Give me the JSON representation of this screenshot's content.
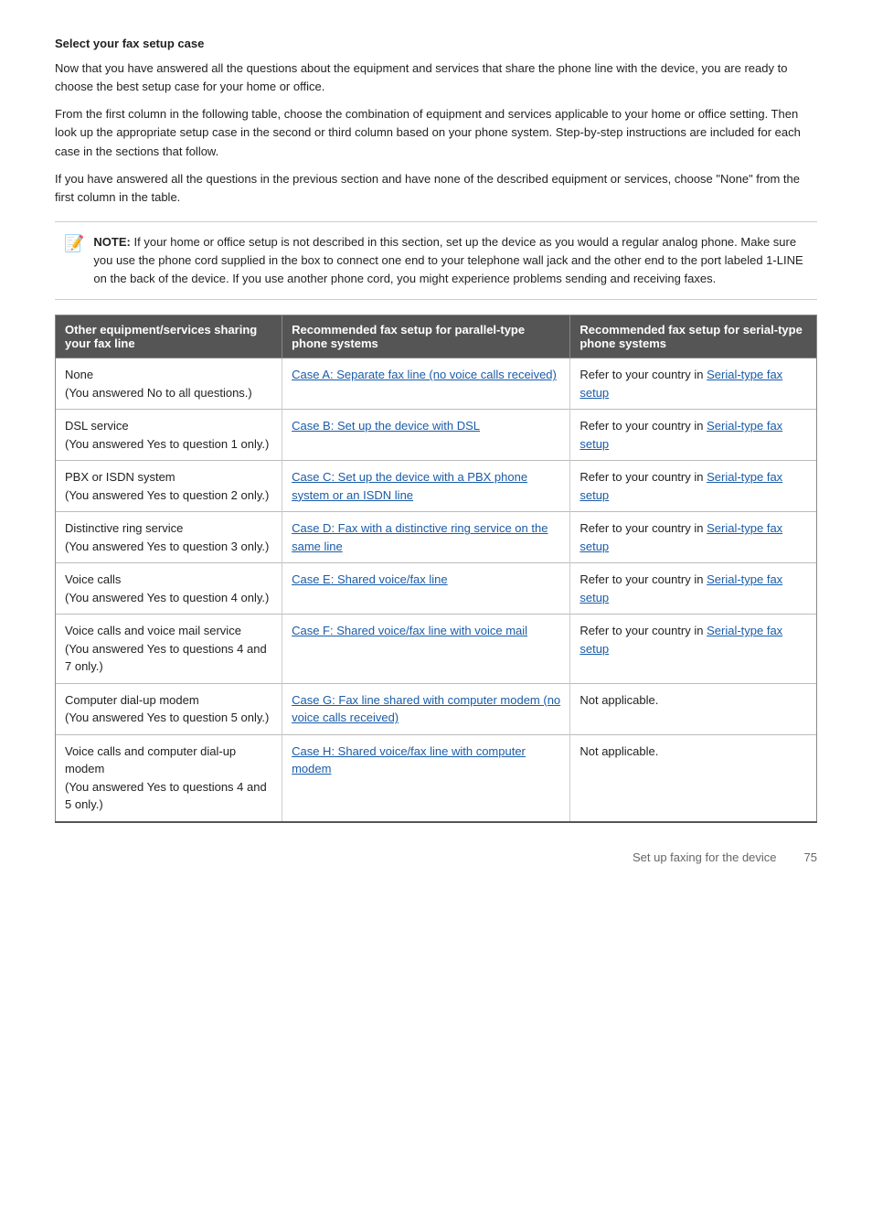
{
  "page": {
    "section_title": "Select your fax setup case",
    "paragraphs": [
      "Now that you have answered all the questions about the equipment and services that share the phone line with the device, you are ready to choose the best setup case for your home or office.",
      "From the first column in the following table, choose the combination of equipment and services applicable to your home or office setting. Then look up the appropriate setup case in the second or third column based on your phone system. Step-by-step instructions are included for each case in the sections that follow.",
      "If you have answered all the questions in the previous section and have none of the described equipment or services, choose \"None\" from the first column in the table."
    ],
    "note_label": "NOTE:",
    "note_text": "If your home or office setup is not described in this section, set up the device as you would a regular analog phone. Make sure you use the phone cord supplied in the box to connect one end to your telephone wall jack and the other end to the port labeled 1-LINE on the back of the device. If you use another phone cord, you might experience problems sending and receiving faxes.",
    "table": {
      "headers": [
        "Other equipment/services sharing your fax line",
        "Recommended fax setup for parallel-type phone systems",
        "Recommended fax setup for serial-type phone systems"
      ],
      "rows": [
        {
          "equipment": "None\n(You answered No to all questions.)",
          "parallel": {
            "text": "Case A: Separate fax line (no voice calls received)",
            "link": true
          },
          "serial": {
            "text": "Refer to your country in Serial-type fax setup",
            "link": true
          }
        },
        {
          "equipment": "DSL service\n(You answered Yes to question 1 only.)",
          "parallel": {
            "text": "Case B: Set up the device with DSL",
            "link": true
          },
          "serial": {
            "text": "Refer to your country in Serial-type fax setup",
            "link": true
          }
        },
        {
          "equipment": "PBX or ISDN system\n(You answered Yes to question 2 only.)",
          "parallel": {
            "text": "Case C: Set up the device with a PBX phone system or an ISDN line",
            "link": true
          },
          "serial": {
            "text": "Refer to your country in Serial-type fax setup",
            "link": true
          }
        },
        {
          "equipment": "Distinctive ring service\n(You answered Yes to question 3 only.)",
          "parallel": {
            "text": "Case D: Fax with a distinctive ring service on the same line",
            "link": true
          },
          "serial": {
            "text": "Refer to your country in Serial-type fax setup",
            "link": true
          }
        },
        {
          "equipment": "Voice calls\n(You answered Yes to question 4 only.)",
          "parallel": {
            "text": "Case E: Shared voice/fax line",
            "link": true
          },
          "serial": {
            "text": "Refer to your country in Serial-type fax setup",
            "link": true
          }
        },
        {
          "equipment": "Voice calls and voice mail service\n(You answered Yes to questions 4 and 7 only.)",
          "parallel": {
            "text": "Case F: Shared voice/fax line with voice mail",
            "link": true
          },
          "serial": {
            "text": "Refer to your country in Serial-type fax setup",
            "link": true
          }
        },
        {
          "equipment": "Computer dial-up modem\n(You answered Yes to question 5 only.)",
          "parallel": {
            "text": "Case G: Fax line shared with computer modem (no voice calls received)",
            "link": true
          },
          "serial": {
            "text": "Not applicable.",
            "link": false
          }
        },
        {
          "equipment": "Voice calls and computer dial-up modem\n(You answered Yes to questions 4 and 5 only.)",
          "parallel": {
            "text": "Case H: Shared voice/fax line with computer modem",
            "link": true
          },
          "serial": {
            "text": "Not applicable.",
            "link": false
          }
        }
      ]
    },
    "footer": {
      "left": "Set up faxing for the device",
      "right": "75"
    }
  }
}
